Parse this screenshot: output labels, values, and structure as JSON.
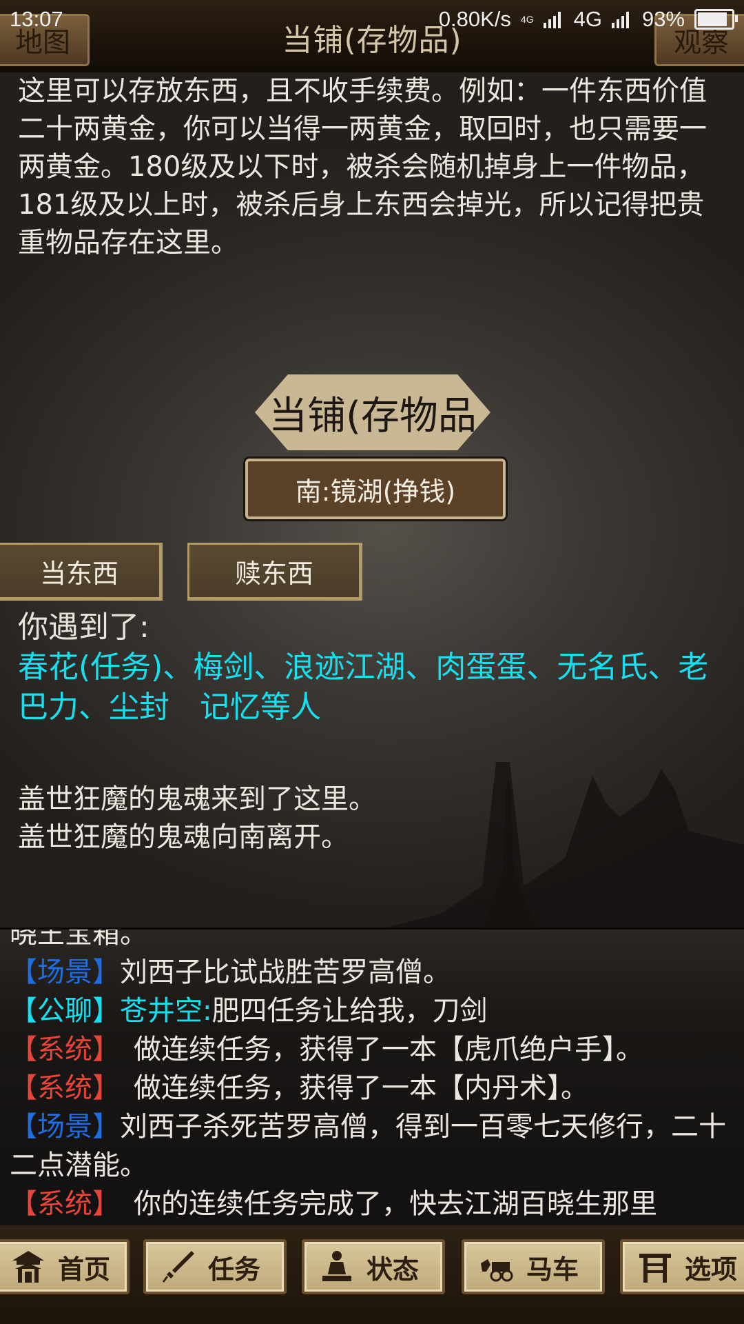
{
  "status_bar": {
    "time": "13:07",
    "net_speed": "0.80K/s",
    "network_small": "4G",
    "network": "4G",
    "battery": "93%"
  },
  "header": {
    "title": "当铺(存物品)",
    "left_button": "地图",
    "right_button": "观察"
  },
  "room": {
    "description": "这里可以存放东西，且不收手续费。例如：一件东西价值二十两黄金，你可以当得一两黄金，取回时，也只需要一两黄金。180级及以下时，被杀会随机掉身上一件物品，181级及以上时，被杀后身上东西会掉光，所以记得把贵重物品存在这里。",
    "name": "当铺(存物品",
    "exit_south": "南:镜湖(挣钱)"
  },
  "actions": {
    "pawn": "当东西",
    "redeem": "赎东西"
  },
  "encounter": {
    "prefix": "你遇到了:",
    "people": "春花(任务)、梅剑、浪迹江湖、肉蛋蛋、无名氏、老巴力、尘封　记忆等人"
  },
  "events": [
    "盖世狂魔的鬼魂来到了这里。",
    "盖世狂魔的鬼魂向南离开。"
  ],
  "chat": {
    "cut_top": "晓王宝箱。",
    "messages": [
      {
        "tag": "【场景】",
        "speaker": "",
        "text": "刘西子比试战胜苦罗高僧。"
      },
      {
        "tag": "【公聊】",
        "speaker": "苍井空:",
        "text": "肥四任务让给我，刀剑"
      },
      {
        "tag": "【系统】",
        "speaker": "",
        "text": "　做连续任务，获得了一本【虎爪绝户手】。"
      },
      {
        "tag": "【系统】",
        "speaker": "",
        "text": "　做连续任务，获得了一本【内丹术】。"
      },
      {
        "tag": "【场景】",
        "speaker": "",
        "text": "刘西子杀死苦罗高僧，得到一百零七天修行，二十二点潜能。"
      },
      {
        "tag": "【系统】",
        "speaker": "",
        "text": "　你的连续任务完成了，快去江湖百晓生那里"
      }
    ]
  },
  "nav": {
    "home": "首页",
    "quest": "任务",
    "status": "状态",
    "carriage": "马车",
    "options": "选项"
  },
  "colors": {
    "npc_cyan": "#16e0f0",
    "scene_blue": "#1f6de0",
    "system_red": "#e8453a",
    "button_brown": "#5a4128"
  }
}
